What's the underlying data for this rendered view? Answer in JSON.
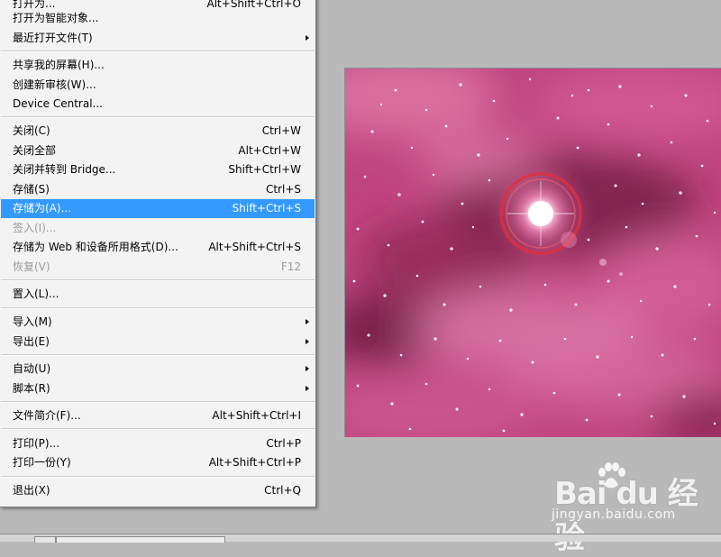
{
  "menu": {
    "items": [
      {
        "label": "打开为...",
        "shortcut": "Alt+Shift+Ctrl+O",
        "submenu": false,
        "disabled": false,
        "active": false
      },
      {
        "label": "打开为智能对象...",
        "shortcut": "",
        "submenu": false,
        "disabled": false,
        "active": false
      },
      {
        "label": "最近打开文件(T)",
        "shortcut": "",
        "submenu": true,
        "disabled": false,
        "active": false
      },
      {
        "label": "共享我的屏幕(H)...",
        "shortcut": "",
        "submenu": false,
        "disabled": false,
        "active": false
      },
      {
        "label": "创建新审核(W)...",
        "shortcut": "",
        "submenu": false,
        "disabled": false,
        "active": false
      },
      {
        "label": "Device Central...",
        "shortcut": "",
        "submenu": false,
        "disabled": false,
        "active": false
      },
      {
        "label": "关闭(C)",
        "shortcut": "Ctrl+W",
        "submenu": false,
        "disabled": false,
        "active": false
      },
      {
        "label": "关闭全部",
        "shortcut": "Alt+Ctrl+W",
        "submenu": false,
        "disabled": false,
        "active": false
      },
      {
        "label": "关闭并转到 Bridge...",
        "shortcut": "Shift+Ctrl+W",
        "submenu": false,
        "disabled": false,
        "active": false
      },
      {
        "label": "存储(S)",
        "shortcut": "Ctrl+S",
        "submenu": false,
        "disabled": false,
        "active": false
      },
      {
        "label": "存储为(A)...",
        "shortcut": "Shift+Ctrl+S",
        "submenu": false,
        "disabled": false,
        "active": true
      },
      {
        "label": "签入(I)...",
        "shortcut": "",
        "submenu": false,
        "disabled": true,
        "active": false
      },
      {
        "label": "存储为 Web 和设备所用格式(D)...",
        "shortcut": "Alt+Shift+Ctrl+S",
        "submenu": false,
        "disabled": false,
        "active": false
      },
      {
        "label": "恢复(V)",
        "shortcut": "F12",
        "submenu": false,
        "disabled": true,
        "active": false
      },
      {
        "label": "置入(L)...",
        "shortcut": "",
        "submenu": false,
        "disabled": false,
        "active": false
      },
      {
        "label": "导入(M)",
        "shortcut": "",
        "submenu": true,
        "disabled": false,
        "active": false
      },
      {
        "label": "导出(E)",
        "shortcut": "",
        "submenu": true,
        "disabled": false,
        "active": false
      },
      {
        "label": "自动(U)",
        "shortcut": "",
        "submenu": true,
        "disabled": false,
        "active": false
      },
      {
        "label": "脚本(R)",
        "shortcut": "",
        "submenu": true,
        "disabled": false,
        "active": false
      },
      {
        "label": "文件简介(F)...",
        "shortcut": "Alt+Shift+Ctrl+I",
        "submenu": false,
        "disabled": false,
        "active": false
      },
      {
        "label": "打印(P)...",
        "shortcut": "Ctrl+P",
        "submenu": false,
        "disabled": false,
        "active": false
      },
      {
        "label": "打印一份(Y)",
        "shortcut": "Alt+Shift+Ctrl+P",
        "submenu": false,
        "disabled": false,
        "active": false
      },
      {
        "label": "退出(X)",
        "shortcut": "Ctrl+Q",
        "submenu": false,
        "disabled": false,
        "active": false
      }
    ]
  },
  "watermark": {
    "logo": "Bai du 经验",
    "url": "jingyan.baidu.com"
  },
  "colors": {
    "menu_background": "#f3f3f3",
    "highlight": "#3399ff",
    "disabled_text": "#9a9a9a",
    "workspace": "#b9b9b9",
    "nebula_base": "#c0447e",
    "flare_ring": "#e0303c"
  }
}
